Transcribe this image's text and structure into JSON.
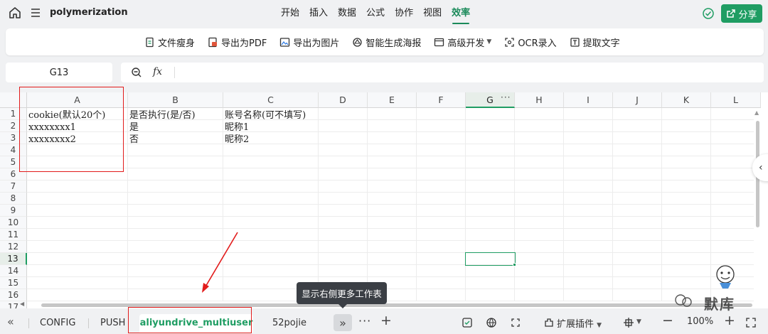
{
  "app": {
    "doc_title": "polymerization",
    "share_label": "分享"
  },
  "menu_tabs": [
    {
      "label": "开始",
      "active": false
    },
    {
      "label": "插入",
      "active": false
    },
    {
      "label": "数据",
      "active": false
    },
    {
      "label": "公式",
      "active": false
    },
    {
      "label": "协作",
      "active": false
    },
    {
      "label": "视图",
      "active": false
    },
    {
      "label": "效率",
      "active": true
    }
  ],
  "toolbar": {
    "items": [
      {
        "label": "文件瘦身",
        "icon": "file-slim-icon"
      },
      {
        "label": "导出为PDF",
        "icon": "export-pdf-icon"
      },
      {
        "label": "导出为图片",
        "icon": "export-image-icon"
      },
      {
        "label": "智能生成海报",
        "icon": "poster-icon"
      },
      {
        "label": "高级开发",
        "icon": "dev-icon",
        "has_dropdown": true
      },
      {
        "label": "OCR录入",
        "icon": "ocr-icon"
      },
      {
        "label": "提取文字",
        "icon": "extract-text-icon"
      }
    ]
  },
  "formula_bar": {
    "cell_ref": "G13",
    "fx_label": "fx",
    "formula": ""
  },
  "grid": {
    "columns": [
      "A",
      "B",
      "C",
      "D",
      "E",
      "F",
      "G",
      "H",
      "I",
      "J",
      "K",
      "L"
    ],
    "selected_column": "G",
    "rows": [
      "1",
      "2",
      "3",
      "4",
      "5",
      "6",
      "7",
      "8",
      "9",
      "10",
      "11",
      "12",
      "13",
      "14",
      "15",
      "16",
      "17"
    ],
    "selected_row": "13",
    "cells": {
      "A1": "cookie(默认20个)",
      "B1": "是否执行(是/否)",
      "C1": "账号名称(可不填写)",
      "A2": "xxxxxxxx1",
      "B2": "是",
      "C2": "昵称1",
      "A3": "xxxxxxxx2",
      "B3": "否",
      "C3": "昵称2"
    }
  },
  "sheets": {
    "tabs": [
      {
        "label": "CONFIG",
        "active": false
      },
      {
        "label": "PUSH",
        "active": false
      },
      {
        "label": "aliyundrive_multiuser",
        "active": true
      },
      {
        "label": "52pojie",
        "active": false
      }
    ],
    "tooltip": "显示右侧更多工作表"
  },
  "statusbar": {
    "plugins_label": "扩展插件",
    "zoom": "100%"
  },
  "watermark": {
    "text": "默库"
  },
  "colors": {
    "accent": "#1f9d63",
    "annotation": "#e21b1b"
  }
}
